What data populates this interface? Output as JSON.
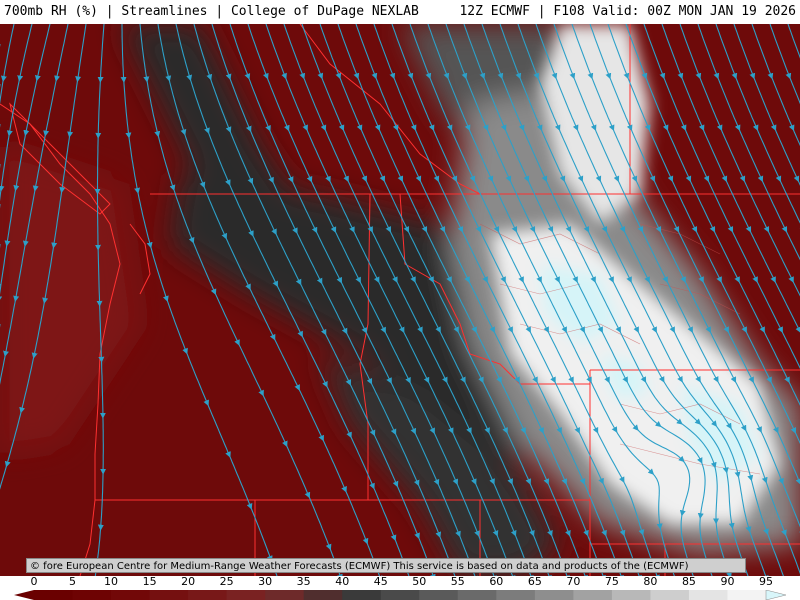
{
  "header": {
    "title_left": "700mb RH (%) | Streamlines | College of DuPage NEXLAB",
    "title_right": "12Z ECMWF | F108 Valid: 00Z MON JAN 19 2026"
  },
  "footer": {
    "credit": "© fore European Centre for Medium-Range Weather Forecasts (ECMWF)  This service is based on data and products of the (ECMWF)"
  },
  "colorbar": {
    "labels": [
      "0",
      "5",
      "10",
      "15",
      "20",
      "25",
      "30",
      "35",
      "40",
      "45",
      "50",
      "55",
      "60",
      "65",
      "70",
      "75",
      "80",
      "85",
      "90",
      "95"
    ],
    "colors": [
      "#6a0000",
      "#6e0303",
      "#720808",
      "#751010",
      "#781818",
      "#7a2222",
      "#6e2a2a",
      "#502e2e",
      "#3a3a3a",
      "#4a4a4a",
      "#5a5a5a",
      "#6a6a6a",
      "#7c7c7c",
      "#8e8e8e",
      "#a2a2a2",
      "#b8b8b8",
      "#cecece",
      "#e4e4e4",
      "#f3f3f3",
      "#d8f6fa"
    ]
  },
  "map": {
    "colors": {
      "dry": "#6e0a0a",
      "dry_light": "#7e1414",
      "mid_dark": "#2a2a2a",
      "mid": "#666666",
      "moist": "#bdbdbd",
      "saturated": "#f0f0f0",
      "ice": "#d6f4f8",
      "streamline": "#2da0c8",
      "boundary": "#ff3030"
    },
    "icons": {
      "streamline_arrow": "arrowhead-icon"
    }
  }
}
